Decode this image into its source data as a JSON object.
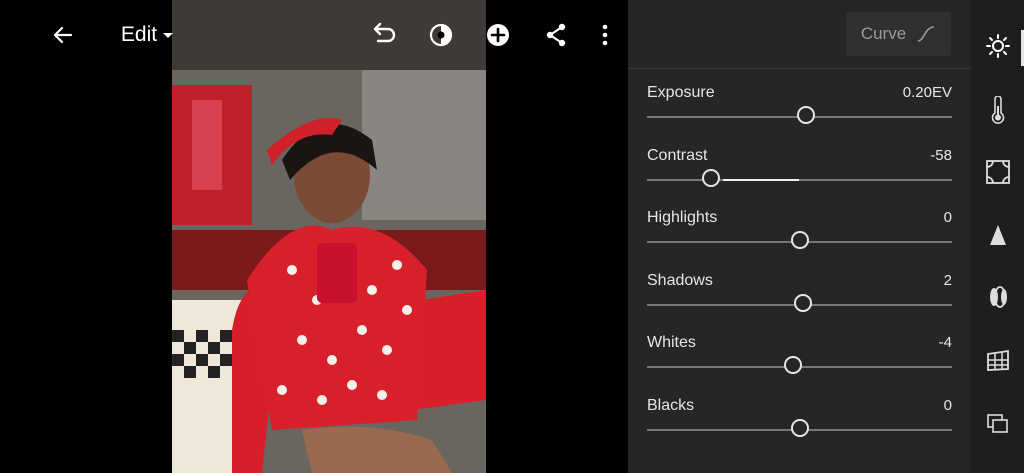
{
  "header": {
    "menu_label": "Edit"
  },
  "panel": {
    "curve_label": "Curve",
    "sliders": [
      {
        "label": "Exposure",
        "value": "0.20EV",
        "position": 0.52
      },
      {
        "label": "Contrast",
        "value": "-58",
        "position": 0.21
      },
      {
        "label": "Highlights",
        "value": "0",
        "position": 0.5
      },
      {
        "label": "Shadows",
        "value": "2",
        "position": 0.51
      },
      {
        "label": "Whites",
        "value": "-4",
        "position": 0.48
      },
      {
        "label": "Blacks",
        "value": "0",
        "position": 0.5
      }
    ]
  },
  "rail": {
    "icons": [
      "light-icon",
      "color-temperature-icon",
      "effects-icon",
      "detail-icon",
      "optics-icon",
      "geometry-icon",
      "versions-icon"
    ],
    "active": "light-icon"
  }
}
